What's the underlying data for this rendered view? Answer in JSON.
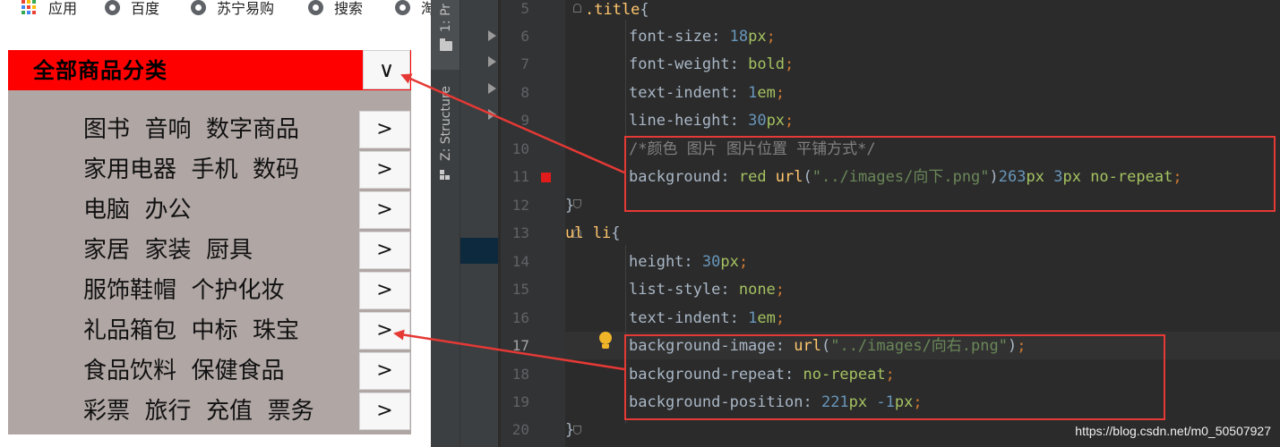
{
  "bookmarks": {
    "apps": "应用",
    "items": [
      "百度",
      "苏宁易购",
      "搜索",
      "淘"
    ]
  },
  "menu": {
    "title": "全部商品分类",
    "title_button": "∨",
    "items": [
      {
        "label": "图书  音响  数字商品",
        "button": ">"
      },
      {
        "label": "家用电器  手机  数码",
        "button": ">"
      },
      {
        "label": "电脑  办公",
        "button": ">"
      },
      {
        "label": "家居  家装  厨具",
        "button": ">"
      },
      {
        "label": "服饰鞋帽  个护化妆",
        "button": ">"
      },
      {
        "label": "礼品箱包  中标  珠宝",
        "button": ">"
      },
      {
        "label": "食品饮料  保健食品",
        "button": ">"
      },
      {
        "label": "彩票  旅行  充值  票务",
        "button": ">"
      }
    ]
  },
  "ide": {
    "tool_windows": [
      "1: Pr",
      "Z: Structure"
    ],
    "line_numbers": [
      "5",
      "6",
      "7",
      "8",
      "9",
      "10",
      "11",
      "12",
      "13",
      "14",
      "15",
      "16",
      "17",
      "18",
      "19",
      "20"
    ],
    "code": {
      "l5": [
        ".title",
        "{"
      ],
      "l6": [
        "font-size",
        ": ",
        "18",
        "px",
        ";"
      ],
      "l7": [
        "font-weight",
        ": ",
        "bold",
        ";"
      ],
      "l8": [
        "text-indent",
        ": ",
        "1",
        "em",
        ";"
      ],
      "l9": [
        "line-height",
        ": ",
        "30",
        "px",
        ";"
      ],
      "l10": [
        "/*颜色 图片 图片位置 平铺方式*/"
      ],
      "l11": [
        "background",
        ": ",
        "red ",
        "url",
        "(",
        "\"../images/向下.png\"",
        ")",
        "263",
        "px ",
        "3",
        "px ",
        "no-repeat",
        ";"
      ],
      "l12": [
        "}"
      ],
      "l13": [
        "ul li",
        "{"
      ],
      "l14": [
        "height",
        ": ",
        "30",
        "px",
        ";"
      ],
      "l15": [
        "list-style",
        ": ",
        "none",
        ";"
      ],
      "l16": [
        "text-indent",
        ": ",
        "1",
        "em",
        ";"
      ],
      "l17": [
        "background-image",
        ": ",
        "url",
        "(",
        "\"../images/向右.png\"",
        ")",
        ";"
      ],
      "l18": [
        "background-repeat",
        ": ",
        "no-repeat",
        ";"
      ],
      "l19": [
        "background-position",
        ": ",
        "221",
        "px ",
        "-1",
        "px",
        ";"
      ],
      "l20": [
        "}"
      ]
    },
    "watermark": "https://blog.csdn.net/m0_50507927"
  },
  "colors": {
    "menu_red": "#ff0000",
    "menu_bg": "#b0a7a5",
    "annotation_red": "#e53935",
    "ide_bg": "#2b2b2b"
  }
}
